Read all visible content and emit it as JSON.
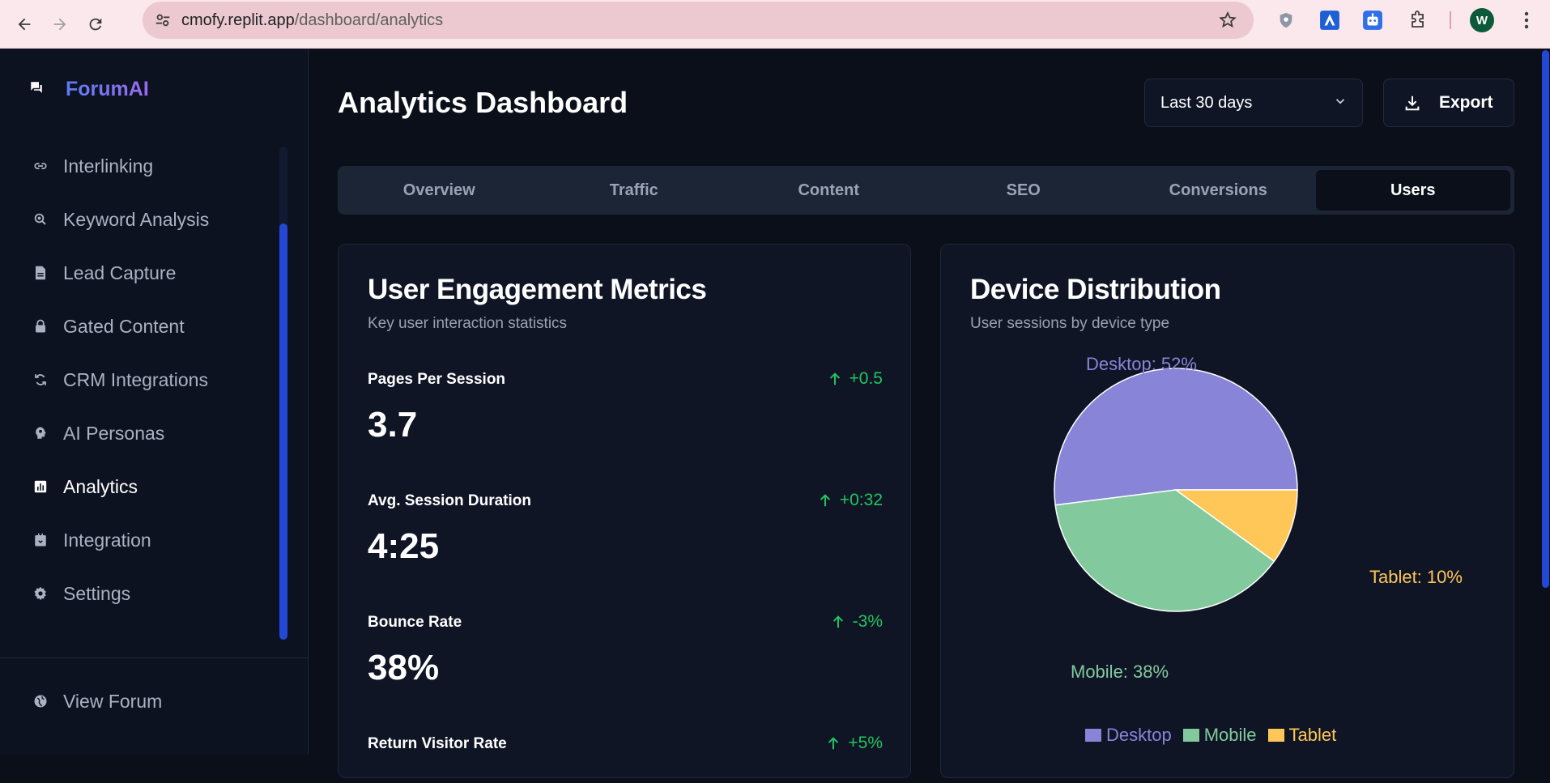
{
  "browser": {
    "url_host": "cmofy.replit.app",
    "url_path": "/dashboard/analytics",
    "profile_initial": "W"
  },
  "sidebar": {
    "brand": "ForumAI",
    "items": [
      {
        "label": "Interlinking",
        "icon": "link-icon"
      },
      {
        "label": "Keyword Analysis",
        "icon": "keyword-search-icon"
      },
      {
        "label": "Lead Capture",
        "icon": "document-icon"
      },
      {
        "label": "Gated Content",
        "icon": "lock-icon"
      },
      {
        "label": "CRM Integrations",
        "icon": "sync-icon"
      },
      {
        "label": "AI Personas",
        "icon": "persona-icon"
      },
      {
        "label": "Analytics",
        "icon": "analytics-icon",
        "active": true
      },
      {
        "label": "Integration",
        "icon": "integration-icon"
      },
      {
        "label": "Settings",
        "icon": "gear-icon"
      }
    ],
    "footer": {
      "label": "View Forum",
      "icon": "globe-icon"
    }
  },
  "header": {
    "title": "Analytics Dashboard",
    "range_value": "Last 30 days",
    "export_label": "Export"
  },
  "tabs": [
    {
      "label": "Overview"
    },
    {
      "label": "Traffic"
    },
    {
      "label": "Content"
    },
    {
      "label": "SEO"
    },
    {
      "label": "Conversions"
    },
    {
      "label": "Users",
      "active": true
    }
  ],
  "engagement": {
    "title": "User Engagement Metrics",
    "subtitle": "Key user interaction statistics",
    "metrics": [
      {
        "label": "Pages Per Session",
        "value": "3.7",
        "delta": "+0.5"
      },
      {
        "label": "Avg. Session Duration",
        "value": "4:25",
        "delta": "+0:32"
      },
      {
        "label": "Bounce Rate",
        "value": "38%",
        "delta": "-3%"
      },
      {
        "label": "Return Visitor Rate",
        "value": "",
        "delta": "+5%"
      }
    ]
  },
  "devices": {
    "title": "Device Distribution",
    "subtitle": "User sessions by device type"
  },
  "chart_data": {
    "type": "pie",
    "categories": [
      "Desktop",
      "Mobile",
      "Tablet"
    ],
    "values": [
      52,
      38,
      10
    ],
    "slice_labels": [
      "Desktop: 52%",
      "Mobile: 38%",
      "Tablet: 10%"
    ],
    "colors": [
      "#8884d8",
      "#82ca9d",
      "#ffc658"
    ],
    "legend": "bottom"
  },
  "colors": {
    "accent": "#2348d6",
    "positive": "#22c55e"
  }
}
